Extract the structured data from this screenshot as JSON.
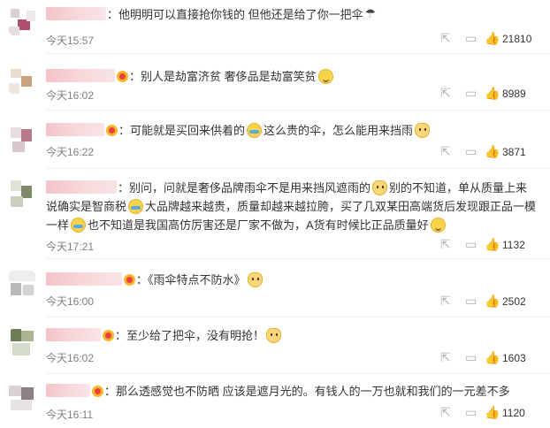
{
  "comments": [
    {
      "text": "他明明可以直接抢你钱的 但他还是给了你一把伞",
      "time": "今天15:57",
      "likes": "21810"
    },
    {
      "text": "别人是劫富济贫 奢侈品是劫富笑贫",
      "time": "今天16:02",
      "likes": "8989"
    },
    {
      "text_a": "可能就是买回来供着的",
      "text_b": "这么贵的伞，怎么能用来挡雨",
      "time": "今天16:22",
      "likes": "3871"
    },
    {
      "text_a": "别问，问就是奢侈品牌雨伞不是用来挡风遮雨的",
      "text_b": "别的不知道，单从质量上来说确实是智商税",
      "text_c": "大品牌越来越贵，质量却越来越拉胯，买了几双某田高端货后发现跟正品一模一样",
      "text_d": "也不知道是我国高仿厉害还是厂家不做为，A货有时候比正品质量好",
      "time": "今天17:21",
      "likes": "1132"
    },
    {
      "text": "《雨伞特点不防水》",
      "time": "今天16:00",
      "likes": "2502"
    },
    {
      "text": "至少给了把伞，没有明抢！",
      "time": "今天16:02",
      "likes": "1603"
    },
    {
      "text": "那么透感觉也不防晒 应该是遮月光的。有钱人的一万也就和我们的一元差不多",
      "time": "今天16:11",
      "likes": "1120"
    }
  ],
  "colon": "：",
  "icons": {
    "share": "share-icon",
    "comment": "comment-icon",
    "like": "thumbs-up-icon"
  }
}
